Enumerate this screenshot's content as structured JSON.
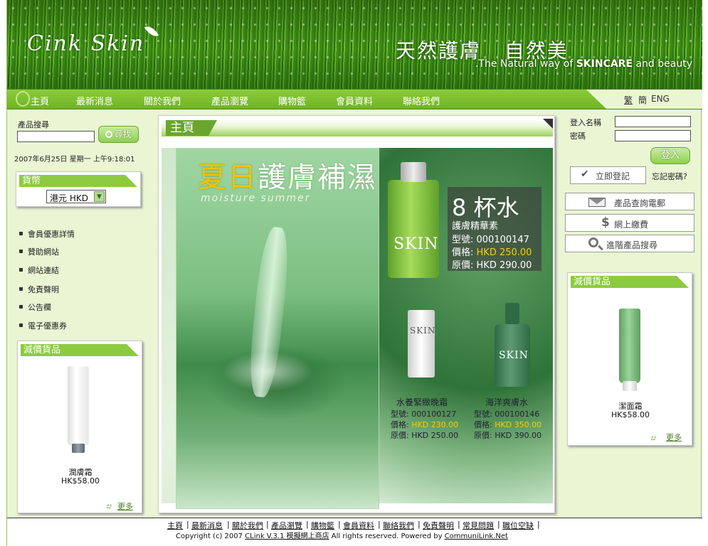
{
  "header": {
    "logo": "Cink Skin",
    "slogan_cn": "天然護膚   自然美",
    "slogan_en_pre": ".The Natural way of ",
    "slogan_en_bold": "SKINCARE",
    "slogan_en_post": " and beauty"
  },
  "nav": {
    "items": [
      "主頁",
      "最新消息",
      "關於我們",
      "產品瀏覽",
      "購物籃",
      "會員資料",
      "聯絡我們"
    ],
    "lang": [
      "繁",
      "簡",
      "ENG"
    ]
  },
  "left": {
    "search_label": "產品搜尋",
    "search_value": "",
    "search_button": "尋找",
    "datetime": "2007年6月25日 星期一 上午9:18:01",
    "currency_title": "貨幣",
    "currency_value": "港元 HKD",
    "links": [
      "會員優惠詳情",
      "贊助網站",
      "網站連結",
      "免責聲明",
      "公告欄",
      "電子優惠券"
    ],
    "sale_title": "減價貨品",
    "sale_name": "潤膚霜",
    "sale_price": "HK$58.00",
    "more": "更多"
  },
  "center": {
    "title": "主頁",
    "promo": {
      "title_hl": "夏日",
      "title_rest": "護膚補濕系列",
      "subtitle": "moisture summer",
      "bottle_label": "SKIN",
      "main": {
        "name_big": "8 杯水",
        "name_sub": "護膚精華素",
        "model": "型號:  000100147",
        "price_label": "價格:  ",
        "price": "HKD 250.00",
        "orig": "原價:  HKD 290.00"
      },
      "items": [
        {
          "name": "水養緊緻晚霜",
          "model": "型號:  000100127",
          "price_label": "價格:  ",
          "price": "HKD 230.00",
          "orig": "原價:  HKD 250.00"
        },
        {
          "name": "海洋爽膚水",
          "model": "型號:  000100146",
          "price_label": "價格:  ",
          "price": "HKD 350.00",
          "orig": "原價:  HKD 390.00"
        }
      ]
    }
  },
  "right": {
    "login_label": "登入名稱",
    "password_label": "密碼",
    "login_value": "",
    "password_value": "",
    "login_button": "登入",
    "register_button": "立即登記",
    "forgot": "忘記密碼?",
    "email_button": "產品查詢電郵",
    "pay_button": "網上繳費",
    "adv_search_button": "進階產品搜尋",
    "sale_title": "減價貨品",
    "sale_name": "潔面霜",
    "sale_price": "HK$58.00",
    "more": "更多"
  },
  "footer": {
    "links": [
      "主頁",
      "最新消息",
      "關於我們",
      "產品瀏覽",
      "購物籃",
      "會員資料",
      "聯絡我們",
      "免責聲明",
      "常見問題",
      "職位空缺"
    ],
    "copy_pre": "Copyright (c) 2007 ",
    "copy_link": "CLink V.3.1 模擬網上商店",
    "copy_mid": " All rights reserved.    Powered by ",
    "copy_link2": "CommuniLink.Net"
  },
  "colors": {
    "accent": "#8ccb40",
    "nav": "#7dbe30",
    "price_highlight": "#f7cf00",
    "page_bg": "#eaf5d4"
  }
}
